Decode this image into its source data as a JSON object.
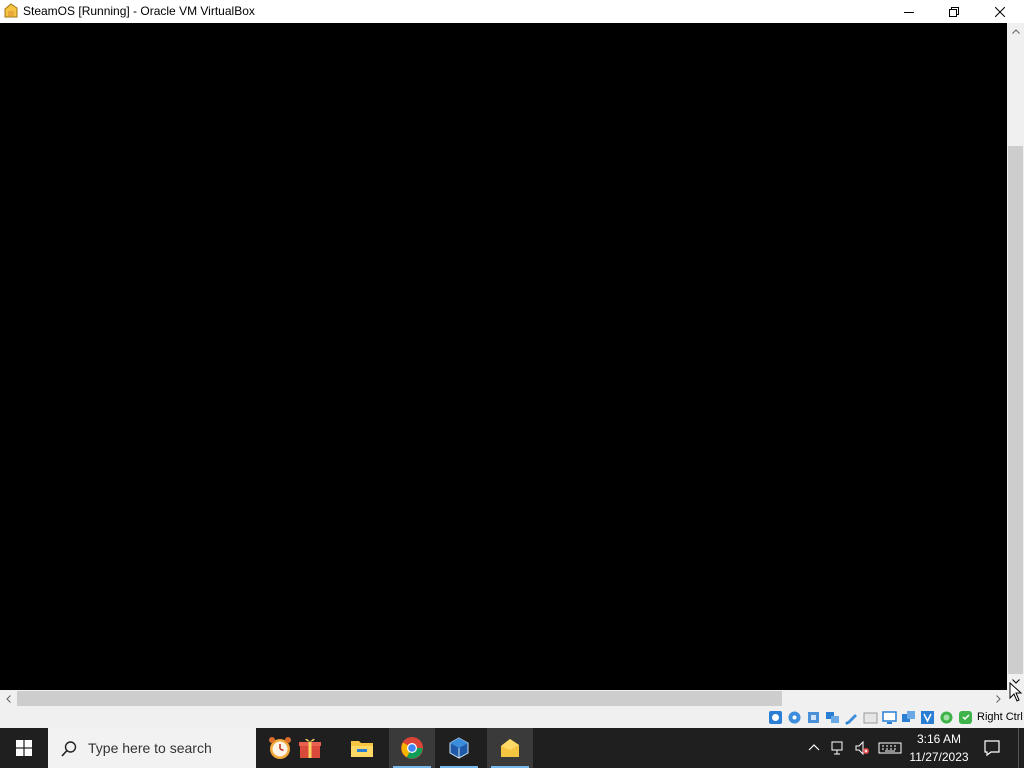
{
  "window": {
    "title": "SteamOS [Running] - Oracle VM VirtualBox",
    "controls": [
      "minimize",
      "restore",
      "close"
    ]
  },
  "statusbar": {
    "indicator_icons": [
      "hard-disk-icon",
      "optical-drive-icon",
      "audio-icon",
      "network-icon",
      "usb-icon",
      "shared-folders-icon",
      "display-icon",
      "video-capture-icon",
      "virtualization-icon",
      "cpu-icon",
      "mouse-integration-icon",
      "keyboard-capture-icon"
    ],
    "host_key": "Right Ctrl"
  },
  "taskbar": {
    "search_placeholder": "Type here to search",
    "apps": [
      "alarms-clock-app",
      "gift-app",
      "file-explorer",
      "chrome",
      "virtualbox-manager",
      "virtualbox-vm-window"
    ],
    "active_app": "virtualbox-vm-window",
    "clock": {
      "time": "3:16 AM",
      "date": "11/27/2023"
    }
  },
  "colors": {
    "vm_screen": "#000000",
    "taskbar": "#1f1f1f",
    "accent": "#76b9ed"
  }
}
